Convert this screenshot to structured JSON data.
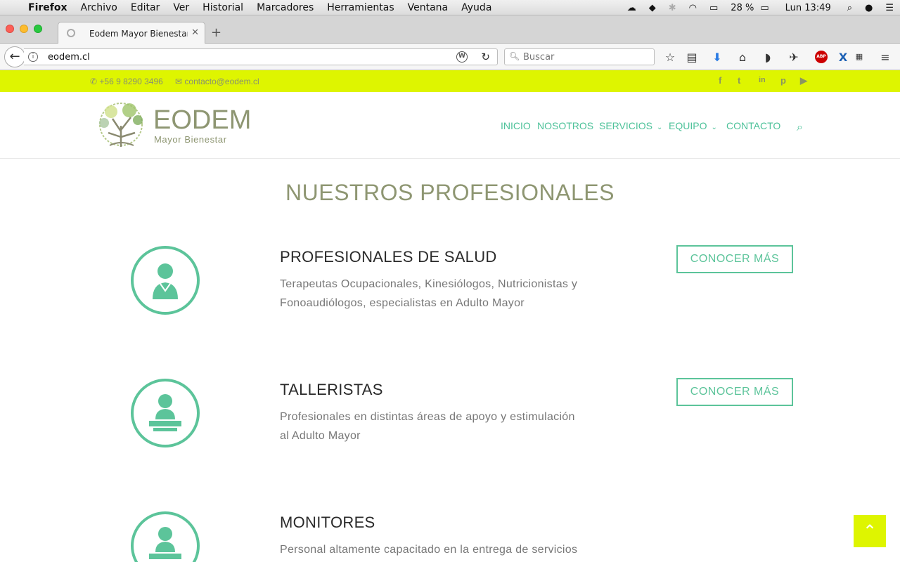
{
  "os_menubar": {
    "app": "Firefox",
    "items": [
      "Archivo",
      "Editar",
      "Ver",
      "Historial",
      "Marcadores",
      "Herramientas",
      "Ventana",
      "Ayuda"
    ],
    "battery": "28 %",
    "clock": "Lun 13:49"
  },
  "browser": {
    "tab_title": "Eodem Mayor Bienestar |",
    "url": "eodem.cl",
    "search_placeholder": "Buscar"
  },
  "topbar": {
    "phone": "+56 9 8290 3496",
    "email": "contacto@eodem.cl",
    "social": [
      "f",
      "t",
      "in",
      "p",
      "yt"
    ]
  },
  "header": {
    "logo_word": "EODEM",
    "logo_sub": "Mayor Bienestar",
    "nav": [
      "INICIO",
      "NOSOTROS",
      "SERVICIOS",
      "EQUIPO",
      "CONTACTO"
    ]
  },
  "main": {
    "title": "NUESTROS PROFESIONALES",
    "sections": [
      {
        "heading": "PROFESIONALES DE SALUD",
        "desc_1": "Terapeutas Ocupacionales, Kinesiólogos, Nutricionistas y",
        "desc_2": "Fonoaudiólogos, especialistas en Adulto Mayor",
        "button": "CONOCER MÁS"
      },
      {
        "heading": "TALLERISTAS",
        "desc_1": "Profesionales en distintas áreas de apoyo y estimulación",
        "desc_2": "al Adulto Mayor",
        "button": "CONOCER MÁS"
      },
      {
        "heading": "MONITORES",
        "desc_1": "Personal altamente capacitado en la entrega de servicios",
        "desc_2": ""
      }
    ]
  },
  "colors": {
    "accent": "#5cc49a",
    "lime": "#def500",
    "olive": "#8e9672"
  }
}
